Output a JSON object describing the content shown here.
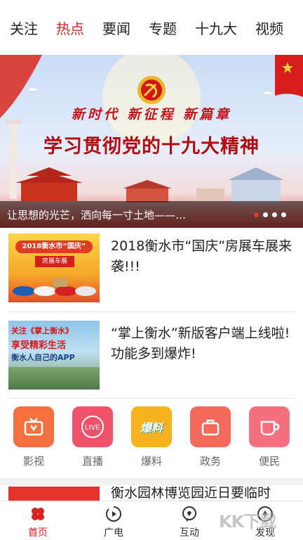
{
  "tabs": [
    {
      "label": "关注",
      "active": false
    },
    {
      "label": "热点",
      "active": true
    },
    {
      "label": "要闻",
      "active": false
    },
    {
      "label": "专题",
      "active": false
    },
    {
      "label": "十九大",
      "active": false
    },
    {
      "label": "视频",
      "active": false
    }
  ],
  "banner": {
    "slogan": "新时代  新征程  新篇章",
    "title": "学习贯彻党的十九大精神",
    "caption": "让思想的光芒，洒向每一寸土地——…",
    "slide_count": 4,
    "active_slide": 1
  },
  "news": [
    {
      "title": "2018衡水市“国庆”房展车展来袭!!!",
      "thumb_heading": "2018衡水市“国庆”",
      "thumb_sub": "房展车展"
    },
    {
      "title": "“掌上衡水”新版客户端上线啦!功能多到爆炸!",
      "thumb_heading": "关注《掌上衡水》",
      "thumb_sub": "享受精彩生活",
      "thumb_sub2": "衡水人自己的APP"
    }
  ],
  "services": [
    {
      "label": "影视",
      "icon": "tv-icon",
      "color": "#f2713f"
    },
    {
      "label": "直播",
      "icon": "live-icon",
      "color": "#f0526a"
    },
    {
      "label": "爆料",
      "icon": "tip-icon",
      "color": "#f7b21f",
      "icon_text": "爆料"
    },
    {
      "label": "政务",
      "icon": "briefcase-icon",
      "color": "#f36a5b"
    },
    {
      "label": "便民",
      "icon": "cup-icon",
      "color": "#f5707e"
    }
  ],
  "next_news_title": "衡水园林博览园近日要临时",
  "bottom_nav": [
    {
      "label": "首页",
      "icon": "home-icon",
      "active": true
    },
    {
      "label": "广电",
      "icon": "broadcast-icon",
      "active": false
    },
    {
      "label": "互动",
      "icon": "interact-icon",
      "active": false
    },
    {
      "label": "发现",
      "icon": "discover-icon",
      "active": false
    }
  ],
  "colors": {
    "accent": "#d9231e"
  },
  "watermark": "KK下载"
}
